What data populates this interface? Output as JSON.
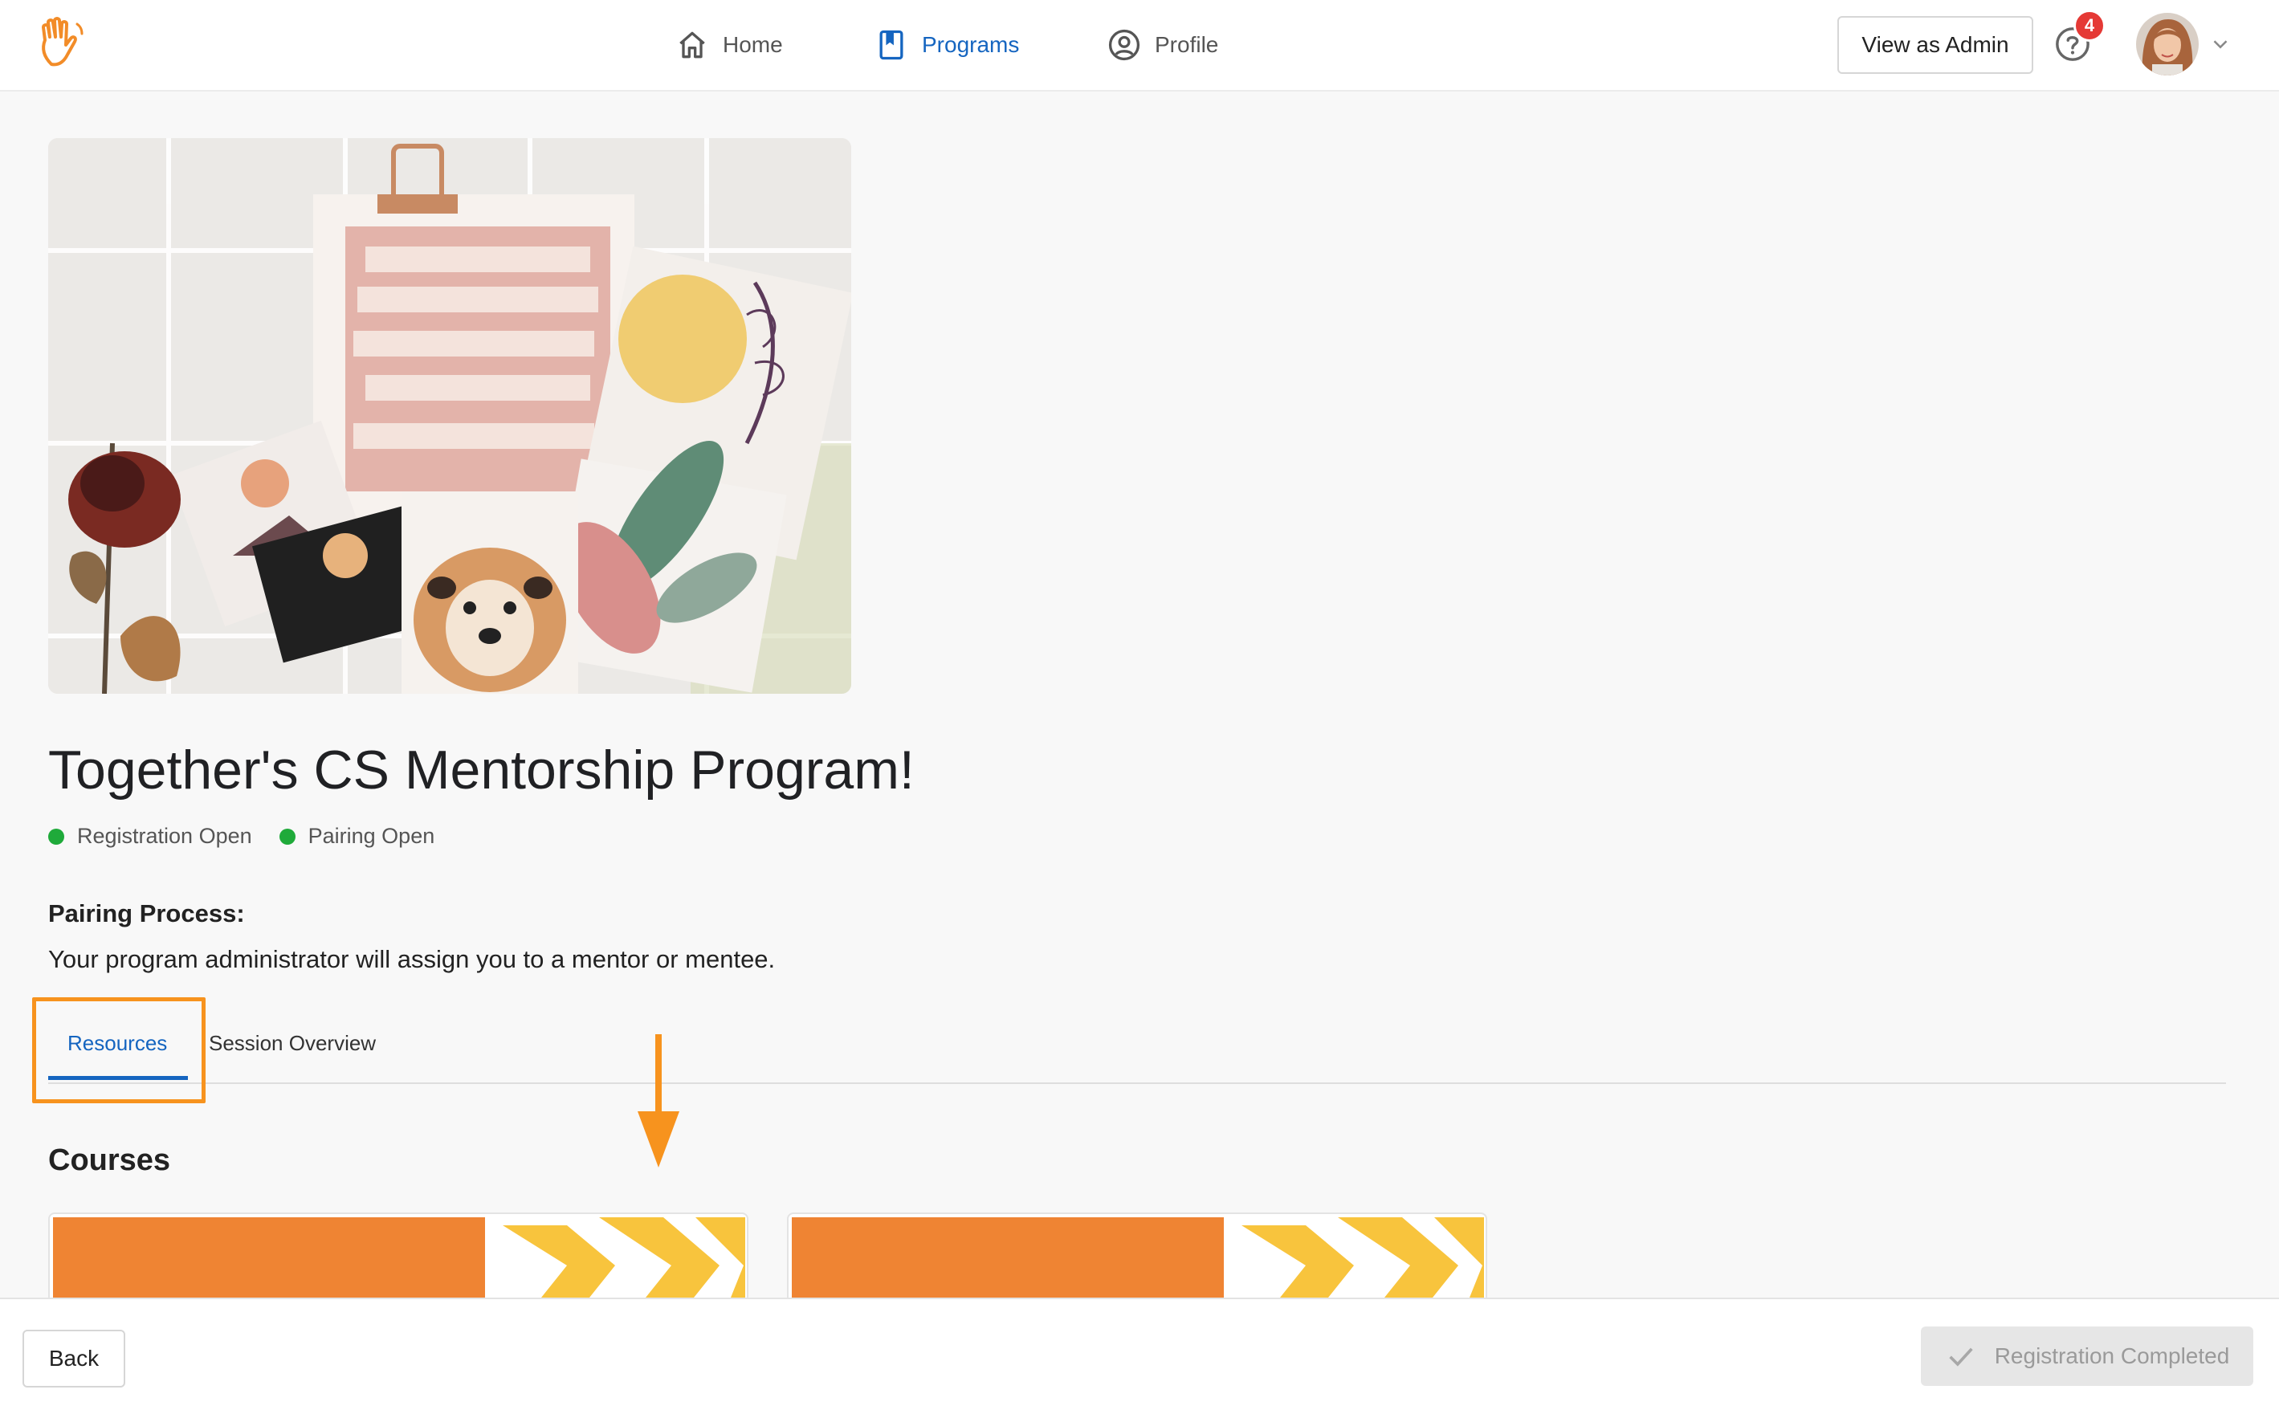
{
  "nav": {
    "items": [
      {
        "label": "Home",
        "icon": "home-icon",
        "active": false
      },
      {
        "label": "Programs",
        "icon": "bookmark-book-icon",
        "active": true
      },
      {
        "label": "Profile",
        "icon": "user-circle-icon",
        "active": false
      }
    ],
    "view_as_admin": "View as Admin",
    "help_badge": "4"
  },
  "program": {
    "title": "Together's CS Mentorship Program!",
    "statuses": [
      {
        "label": "Registration Open",
        "color": "#1faa3a"
      },
      {
        "label": "Pairing Open",
        "color": "#1faa3a"
      }
    ],
    "pairing_label": "Pairing Process:",
    "pairing_text": "Your program administrator will assign you to a mentor or mentee."
  },
  "tabs": [
    {
      "label": "Resources",
      "active": true
    },
    {
      "label": "Session Overview",
      "active": false
    }
  ],
  "courses": {
    "title": "Courses"
  },
  "footer": {
    "back": "Back",
    "registration": "Registration Completed"
  },
  "colors": {
    "accent": "#1565c0",
    "highlight": "#f7931e",
    "course_orange": "#ef8433",
    "course_yellow": "#f8c43d"
  }
}
